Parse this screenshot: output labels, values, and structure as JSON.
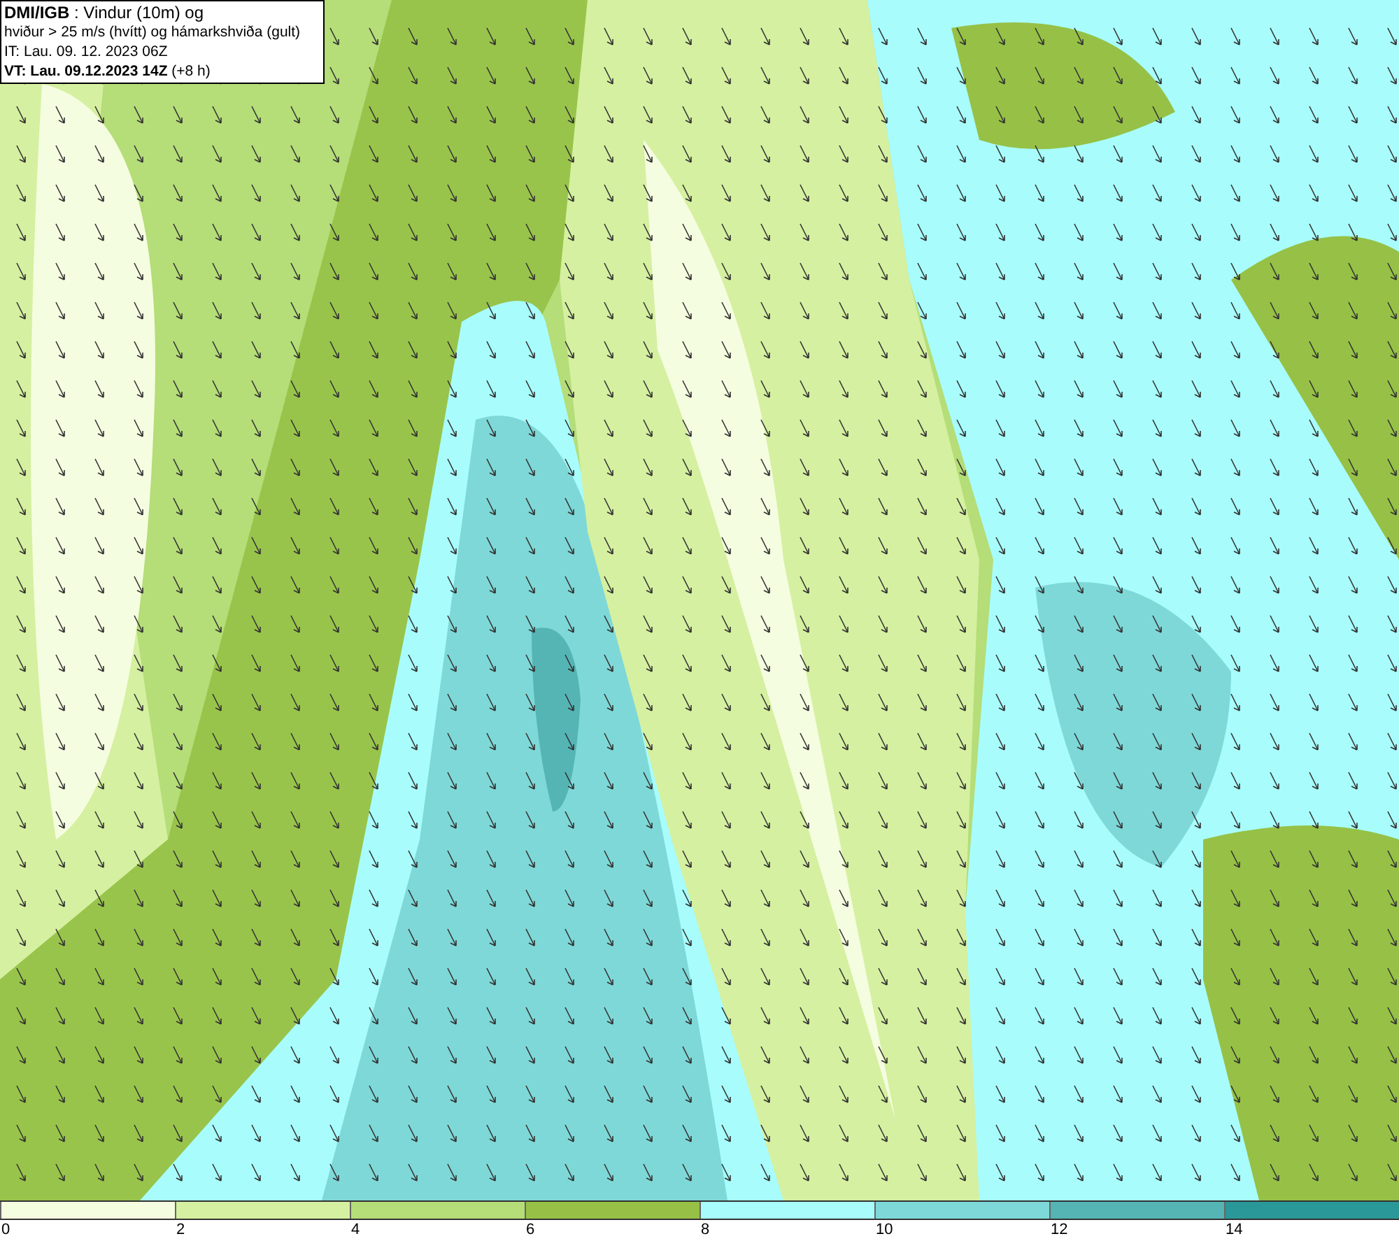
{
  "header": {
    "lines": [
      "**DMI/IGB** : Vindur (10m) og",
      "hviður > 25 m/s (hvítt) og hámarkshviða (gult)",
      "IT: Lau. 09. 12. 2023 06Z",
      "**VT: Lau. 09.12.2023 14Z** (+8 h)"
    ]
  },
  "legend": {
    "segments": [
      {
        "color": "#f5fde0"
      },
      {
        "color": "#d5f0a0"
      },
      {
        "color": "#b5dd78"
      },
      {
        "color": "#96c146"
      },
      {
        "color": "#a8fcfc"
      },
      {
        "color": "#7fd8d8"
      },
      {
        "color": "#55b5b5"
      },
      {
        "color": "#2a9898"
      }
    ],
    "ticks": [
      "0",
      "2",
      "4",
      "6",
      "8",
      "10",
      "12",
      "14"
    ]
  }
}
